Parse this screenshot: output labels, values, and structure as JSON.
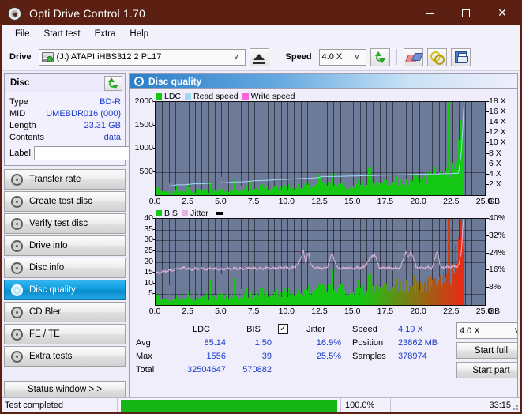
{
  "window": {
    "title": "Opti Drive Control 1.70",
    "app_icon": "disc-icon",
    "minimize": "–",
    "maximize": "□",
    "close": "✕"
  },
  "menu": {
    "items": [
      "File",
      "Start test",
      "Extra",
      "Help"
    ]
  },
  "toolbar": {
    "drive_label": "Drive",
    "drive_value": "(J:)  ATAPI iHBS312   2 PL17",
    "eject_icon": "eject-icon",
    "speed_label": "Speed",
    "speed_value": "4.0 X",
    "refresh_icon": "refresh-icon",
    "erase_icon": "eraser-icon",
    "chain_icon": "chain-icon",
    "save_icon": "save-icon",
    "chevron": "∨"
  },
  "disc_panel": {
    "header": "Disc",
    "refresh_icon": "refresh-icon",
    "rows": [
      {
        "key": "Type",
        "value": "BD-R"
      },
      {
        "key": "MID",
        "value": "UMEBDR016 (000)"
      },
      {
        "key": "Length",
        "value": "23.31 GB"
      },
      {
        "key": "Contents",
        "value": "data"
      }
    ],
    "label_key": "Label",
    "label_value": "",
    "label_placeholder": "",
    "disc_button_icon": "cd-icon"
  },
  "sidebar": {
    "items": [
      {
        "label": "Transfer rate",
        "active": false
      },
      {
        "label": "Create test disc",
        "active": false
      },
      {
        "label": "Verify test disc",
        "active": false
      },
      {
        "label": "Drive info",
        "active": false
      },
      {
        "label": "Disc info",
        "active": false
      },
      {
        "label": "Disc quality",
        "active": true
      },
      {
        "label": "CD Bler",
        "active": false
      },
      {
        "label": "FE / TE",
        "active": false
      },
      {
        "label": "Extra tests",
        "active": false
      }
    ],
    "status_window_button": "Status window > >"
  },
  "panel": {
    "title": "Disc quality",
    "title_icon": "disc-quality-icon"
  },
  "stats": {
    "col_headers": [
      "LDC",
      "BIS"
    ],
    "row_keys": [
      "Avg",
      "Max",
      "Total"
    ],
    "ldc": {
      "avg": "85.14",
      "max": "1556",
      "total": "32504647"
    },
    "bis": {
      "avg": "1.50",
      "max": "39",
      "total": "570882"
    },
    "jitter": {
      "label": "Jitter",
      "checked": true,
      "check_glyph": "✓",
      "avg": "16.9%",
      "max": "25.5%"
    },
    "speed_key": "Speed",
    "speed_value": "4.19 X",
    "position_key": "Position",
    "position_value": "23862 MB",
    "samples_key": "Samples",
    "samples_value": "378974",
    "speed_select": "4.0 X",
    "speed_select_chevron": "∨",
    "start_full": "Start full",
    "start_part": "Start part"
  },
  "statusbar": {
    "message": "Test completed",
    "progress_percent": "100.0%",
    "progress_value": 100,
    "elapsed": "33:15"
  },
  "colors": {
    "titlebar": "#5c2012",
    "accent_blue": "#1a3ccc",
    "ldc_green": "#14c814",
    "read_speed": "#9fd8f5",
    "write_speed": "#ff66dd",
    "bis_green": "#14c814",
    "jitter_pink": "#e4b4e0",
    "plot_bg": "#6d7b98",
    "progress_green": "#14b514",
    "active_nav": "#0f9ddd"
  },
  "chart_data": [
    {
      "type": "area",
      "id": "disc-quality-ldc",
      "title": "Disc quality",
      "xlabel": "GB",
      "ylabel": "LDC",
      "xlim": [
        0,
        25
      ],
      "ylim": [
        0,
        2000
      ],
      "y2lim": [
        0,
        18
      ],
      "y2label": "X",
      "grid": true,
      "legend": [
        "LDC",
        "Read speed",
        "Write speed"
      ],
      "legend_colors": [
        "#14c814",
        "#9fd8f5",
        "#ff66dd"
      ],
      "legend_position": "top-left",
      "xticks": [
        "0.0",
        "2.5",
        "5.0",
        "7.5",
        "10.0",
        "12.5",
        "15.0",
        "17.5",
        "20.0",
        "22.5",
        "25.0"
      ],
      "yticks": [
        "500",
        "1000",
        "1500",
        "2000"
      ],
      "y2ticks": [
        "2 X",
        "4 X",
        "6 X",
        "8 X",
        "10 X",
        "12 X",
        "14 X",
        "16 X",
        "18 X"
      ],
      "data_end_gb": 23.4,
      "series": [
        {
          "name": "LDC",
          "color": "#14c814",
          "x": [
            0.0,
            0.2,
            0.4,
            0.6,
            0.8,
            1.0,
            1.2,
            1.4,
            1.6,
            1.8,
            2.0,
            2.2,
            2.4,
            2.6,
            2.8,
            3.0,
            3.2,
            3.4,
            3.6,
            3.8,
            4.0,
            4.2,
            4.4,
            4.6,
            4.8,
            5.0,
            5.2,
            5.4,
            5.6,
            5.8,
            6.0,
            6.2,
            6.4,
            6.6,
            6.8,
            7.0,
            7.2,
            7.4,
            7.6,
            7.8,
            8.0,
            8.2,
            8.4,
            8.6,
            8.8,
            9.0,
            9.2,
            9.4,
            9.6,
            9.8,
            10.0,
            10.2,
            10.4,
            10.6,
            10.8,
            11.0,
            11.2,
            11.4,
            11.6,
            11.8,
            12.0,
            12.2,
            12.4,
            12.6,
            12.8,
            13.0,
            13.2,
            13.4,
            13.6,
            13.8,
            14.0,
            14.2,
            14.4,
            14.6,
            14.8,
            15.0,
            15.2,
            15.4,
            15.6,
            15.8,
            16.0,
            16.2,
            16.4,
            16.6,
            16.8,
            17.0,
            17.2,
            17.4,
            17.6,
            17.8,
            18.0,
            18.2,
            18.4,
            18.6,
            18.8,
            19.0,
            19.2,
            19.4,
            19.6,
            19.8,
            20.0,
            20.2,
            20.4,
            20.6,
            20.8,
            21.0,
            21.2,
            21.4,
            21.6,
            21.8,
            22.0,
            22.2,
            22.4,
            22.6,
            22.8,
            23.0,
            23.1,
            23.2,
            23.3,
            23.4
          ],
          "y": [
            290,
            170,
            110,
            100,
            95,
            90,
            95,
            100,
            230,
            110,
            105,
            100,
            260,
            120,
            115,
            110,
            310,
            125,
            120,
            115,
            130,
            125,
            120,
            130,
            135,
            140,
            135,
            145,
            150,
            155,
            160,
            165,
            160,
            170,
            175,
            180,
            310,
            185,
            180,
            190,
            195,
            200,
            195,
            205,
            210,
            200,
            205,
            215,
            210,
            220,
            215,
            225,
            220,
            230,
            235,
            225,
            230,
            240,
            235,
            245,
            250,
            240,
            420,
            250,
            245,
            255,
            260,
            250,
            265,
            270,
            260,
            275,
            280,
            270,
            285,
            300,
            290,
            280,
            295,
            300,
            310,
            760,
            330,
            320,
            340,
            350,
            330,
            345,
            360,
            350,
            365,
            380,
            370,
            390,
            400,
            380,
            410,
            420,
            400,
            430,
            440,
            420,
            450,
            470,
            450,
            480,
            620,
            500,
            530,
            560,
            600,
            640,
            700,
            820,
            980,
            1200,
            1450,
            1556,
            1300,
            900
          ]
        },
        {
          "name": "Read speed",
          "color": "#9fd8f5",
          "axis": "y2",
          "x": [
            0.0,
            1.0,
            1.6,
            2.2,
            2.9,
            3.6,
            4.3,
            5.2,
            6.0,
            6.8,
            7.6,
            8.4,
            9.2,
            10.0,
            10.8,
            11.6,
            12.4,
            12.6,
            13.4,
            14.2,
            15.0,
            15.8,
            16.6,
            17.4,
            18.2,
            19.0,
            19.8,
            20.6,
            21.4,
            22.0,
            22.6,
            23.0,
            23.2,
            23.35,
            23.4
          ],
          "y": [
            1.75,
            1.75,
            2.0,
            2.0,
            2.2,
            2.2,
            2.35,
            2.4,
            2.55,
            2.6,
            2.8,
            2.85,
            3.0,
            3.05,
            3.2,
            3.25,
            3.4,
            3.6,
            3.6,
            3.65,
            3.7,
            3.75,
            3.8,
            3.85,
            3.9,
            3.95,
            4.0,
            4.05,
            4.1,
            4.15,
            4.2,
            4.2,
            8.0,
            14.0,
            18.0
          ]
        },
        {
          "name": "Write speed",
          "color": "#ff66dd",
          "x": [],
          "y": []
        }
      ]
    },
    {
      "type": "area",
      "id": "disc-quality-bis",
      "xlabel": "GB",
      "ylabel": "BIS",
      "xlim": [
        0,
        25
      ],
      "ylim": [
        0,
        40
      ],
      "y2lim": [
        0,
        40
      ],
      "y2label": "%",
      "grid": true,
      "legend": [
        "BIS",
        "Jitter"
      ],
      "legend_colors": [
        "#14c814",
        "#e4b4e0"
      ],
      "legend_position": "top-left",
      "xticks": [
        "0.0",
        "2.5",
        "5.0",
        "7.5",
        "10.0",
        "12.5",
        "15.0",
        "17.5",
        "20.0",
        "22.5",
        "25.0"
      ],
      "yticks": [
        "5",
        "10",
        "15",
        "20",
        "25",
        "30",
        "35",
        "40"
      ],
      "y2ticks": [
        "8%",
        "16%",
        "24%",
        "32%",
        "40%"
      ],
      "data_end_gb": 23.4,
      "series": [
        {
          "name": "BIS",
          "color": "#14c814",
          "x": [
            0.0,
            0.2,
            0.4,
            0.6,
            0.8,
            1.0,
            1.2,
            1.4,
            1.6,
            1.8,
            2.0,
            2.2,
            2.4,
            2.6,
            2.8,
            3.0,
            3.2,
            3.4,
            3.6,
            3.8,
            4.0,
            4.2,
            4.4,
            4.6,
            4.8,
            5.0,
            5.2,
            5.4,
            5.6,
            5.8,
            6.0,
            6.2,
            6.4,
            6.6,
            6.8,
            7.0,
            7.2,
            7.4,
            7.6,
            7.8,
            8.0,
            8.2,
            8.4,
            8.6,
            8.8,
            9.0,
            9.2,
            9.4,
            9.6,
            9.8,
            10.0,
            10.2,
            10.4,
            10.6,
            10.8,
            11.0,
            11.2,
            11.4,
            11.6,
            11.8,
            12.0,
            12.2,
            12.4,
            12.6,
            12.8,
            13.0,
            13.2,
            13.4,
            13.6,
            13.8,
            14.0,
            14.2,
            14.4,
            14.6,
            14.8,
            15.0,
            15.2,
            15.4,
            15.6,
            15.8,
            16.0,
            16.2,
            16.4,
            16.6,
            16.8,
            17.0,
            17.2,
            17.4,
            17.6,
            17.8,
            18.0,
            18.2,
            18.4,
            18.6,
            18.8,
            19.0,
            19.2,
            19.4,
            19.6,
            19.8,
            20.0,
            20.2,
            20.4,
            20.6,
            20.8,
            21.0,
            21.2,
            21.4,
            21.6,
            21.8,
            22.0,
            22.2,
            22.4,
            22.6,
            22.8,
            23.0,
            23.1,
            23.2,
            23.3,
            23.4
          ],
          "y": [
            8,
            5,
            3,
            3,
            4,
            3,
            4,
            3,
            5,
            4,
            3,
            4,
            6,
            4,
            5,
            4,
            6,
            5,
            4,
            5,
            5,
            5,
            4,
            5,
            6,
            5,
            5,
            6,
            5,
            6,
            6,
            5,
            6,
            7,
            6,
            7,
            6,
            7,
            6,
            7,
            7,
            6,
            7,
            7,
            6,
            7,
            7,
            8,
            7,
            8,
            7,
            8,
            7,
            8,
            7,
            8,
            8,
            7,
            8,
            8,
            9,
            8,
            9,
            8,
            9,
            8,
            9,
            9,
            8,
            9,
            9,
            10,
            9,
            10,
            9,
            10,
            9,
            10,
            10,
            9,
            10,
            17,
            10,
            11,
            10,
            11,
            10,
            11,
            11,
            10,
            11,
            12,
            11,
            12,
            11,
            12,
            11,
            12,
            12,
            11,
            12,
            12,
            11,
            12,
            12,
            13,
            12,
            13,
            14,
            13,
            15,
            16,
            18,
            22,
            26,
            31,
            35,
            39,
            32,
            20
          ]
        },
        {
          "name": "Jitter",
          "color": "#e4b4e0",
          "axis": "y2",
          "x": [
            0.0,
            0.3,
            0.6,
            1.0,
            1.4,
            1.8,
            2.2,
            2.6,
            3.0,
            3.4,
            3.8,
            4.2,
            4.6,
            5.0,
            5.4,
            5.8,
            6.2,
            6.6,
            7.0,
            7.4,
            7.8,
            8.2,
            8.6,
            9.0,
            9.4,
            9.8,
            10.2,
            10.6,
            11.0,
            11.2,
            11.4,
            11.6,
            11.8,
            12.2,
            12.6,
            13.0,
            13.4,
            13.8,
            14.2,
            14.4,
            14.6,
            15.0,
            15.4,
            15.8,
            16.2,
            16.6,
            17.0,
            17.2,
            17.4,
            17.8,
            18.2,
            18.6,
            19.0,
            19.2,
            19.4,
            19.8,
            20.2,
            20.6,
            21.0,
            21.4,
            21.6,
            21.8,
            22.2,
            22.6,
            23.0,
            23.2,
            23.3,
            23.35
          ],
          "y": [
            14.8,
            15.0,
            15.5,
            16.0,
            16.3,
            17.0,
            17.3,
            16.5,
            16.8,
            17.0,
            16.5,
            17.0,
            16.8,
            16.5,
            17.0,
            16.8,
            17.0,
            16.8,
            17.0,
            17.2,
            16.8,
            17.0,
            17.2,
            17.0,
            17.2,
            17.4,
            17.0,
            17.6,
            21.0,
            25.8,
            19.0,
            25.5,
            18.0,
            17.2,
            17.0,
            17.2,
            24.0,
            17.0,
            17.2,
            17.0,
            17.2,
            17.0,
            17.4,
            17.2,
            21.0,
            24.0,
            17.2,
            17.0,
            17.4,
            17.2,
            17.0,
            17.4,
            25.0,
            21.8,
            25.0,
            17.4,
            17.2,
            17.4,
            17.2,
            25.5,
            18.0,
            17.4,
            17.6,
            17.8,
            18.2,
            24.0,
            33.0,
            40.0
          ]
        }
      ]
    }
  ]
}
